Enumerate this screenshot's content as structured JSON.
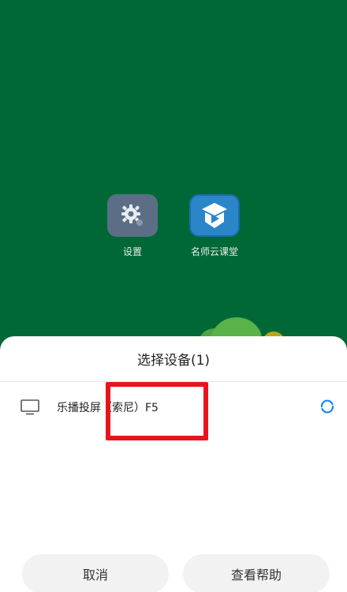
{
  "home_screen": {
    "apps": [
      {
        "label": "设置",
        "icon": "gear-icon"
      },
      {
        "label": "名师云课堂",
        "icon": "play-book-icon"
      }
    ]
  },
  "dialog": {
    "title": "选择设备(1)",
    "devices": [
      {
        "name": "乐播投屏（索尼）F5",
        "icon": "tv-icon",
        "status_icon": "loading-spinner-icon"
      }
    ],
    "cancel_label": "取消",
    "help_label": "查看帮助"
  },
  "colors": {
    "wallpaper": "#006837",
    "accent": "#1e88e5",
    "highlight": "#e8141c"
  }
}
